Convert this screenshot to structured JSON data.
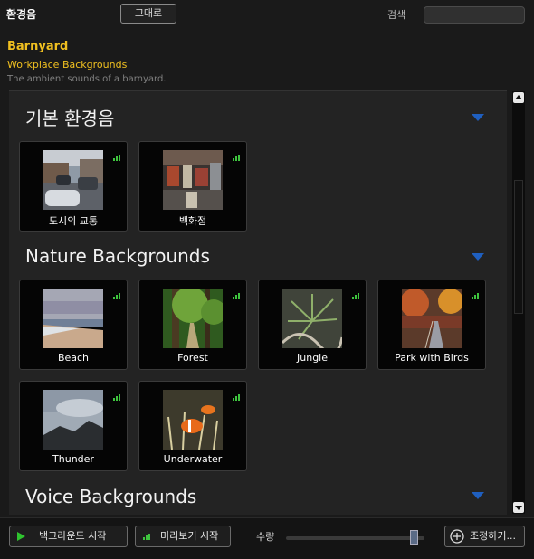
{
  "header": {
    "title": "환경음",
    "reset_label": "그대로",
    "search_label": "검색",
    "search_value": "",
    "search_placeholder": ""
  },
  "selection": {
    "name": "Barnyard",
    "category": "Workplace Backgrounds",
    "description": "The ambient sounds of a barnyard."
  },
  "sections": [
    {
      "title": "기본 환경음",
      "items": [
        {
          "label": "도시의 교통"
        },
        {
          "label": "백화점"
        }
      ]
    },
    {
      "title": "Nature Backgrounds",
      "items": [
        {
          "label": "Beach"
        },
        {
          "label": "Forest"
        },
        {
          "label": "Jungle"
        },
        {
          "label": "Park with Birds"
        },
        {
          "label": "Thunder"
        },
        {
          "label": "Underwater"
        }
      ]
    },
    {
      "title": "Voice Backgrounds",
      "items": []
    }
  ],
  "footer": {
    "start_label": "백그라운드 시작",
    "preview_label": "미리보기 시작",
    "volume_label": "수량",
    "volume_level": 0.95,
    "adjust_label": "조정하기..."
  },
  "colors": {
    "accent_yellow": "#f0c020",
    "chevron_blue": "#1f5fbf",
    "signal_green": "#3ec43e"
  },
  "icons": [
    "chevron-down-icon",
    "signal-bars-icon",
    "play-icon",
    "plus-circle-icon",
    "scroll-up-arrow-icon",
    "scroll-down-arrow-icon"
  ]
}
